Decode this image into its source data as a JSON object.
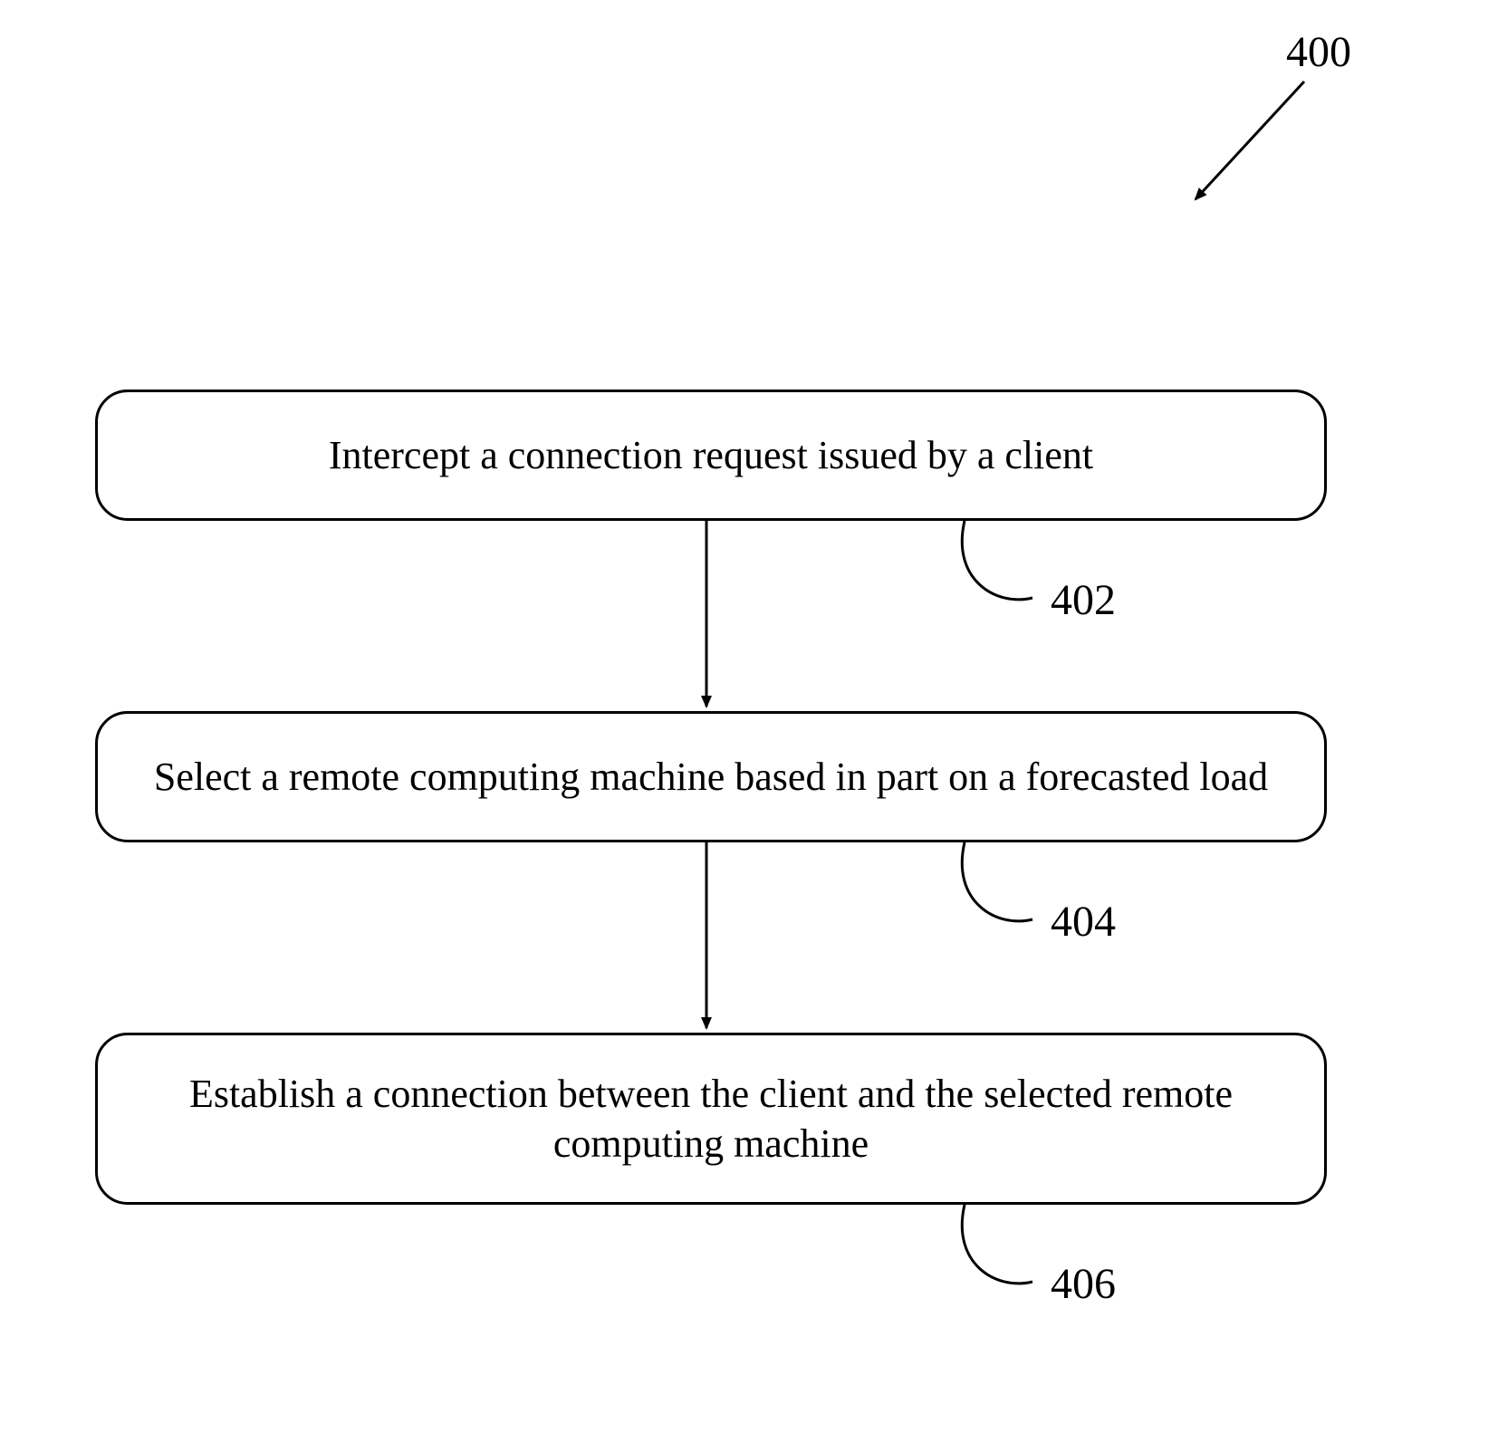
{
  "diagram": {
    "ref_label": "400",
    "steps": [
      {
        "text": "Intercept a connection request issued by a client",
        "ref": "402"
      },
      {
        "text": "Select a remote computing machine based in part on a forecasted load",
        "ref": "404"
      },
      {
        "text": "Establish a connection between the client and the selected remote computing machine",
        "ref": "406"
      }
    ]
  }
}
